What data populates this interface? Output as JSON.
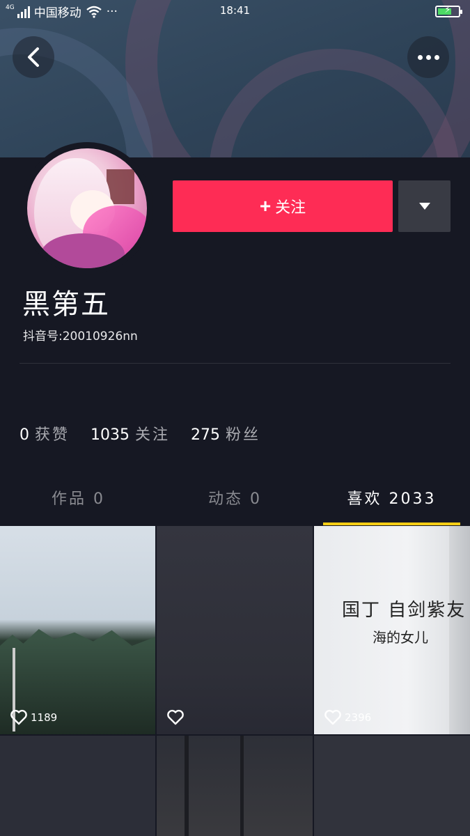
{
  "status_bar": {
    "network": "4G",
    "carrier": "中国移动",
    "more": "···",
    "time": "18:41"
  },
  "profile": {
    "nickname": "黑第五",
    "douyin_id": "抖音号:20010926nn",
    "follow_label": "关注",
    "follow_plus": "+"
  },
  "stats": [
    {
      "num": "0",
      "label": "获赞"
    },
    {
      "num": "1035",
      "label": "关注"
    },
    {
      "num": "275",
      "label": "粉丝"
    }
  ],
  "tabs": [
    {
      "label": "作品 0"
    },
    {
      "label": "动态 0"
    },
    {
      "label": "喜欢 2033"
    }
  ],
  "videos": [
    {
      "likes": "1189"
    },
    {
      "likes": ""
    },
    {
      "likes": "2396",
      "text_line1": "国丁 自剑紫友",
      "text_line2": "海的女儿"
    }
  ],
  "colors": {
    "background": "#161823",
    "follow": "#fe2c55",
    "tab_underline": "#face15"
  },
  "icons": [
    "back-icon",
    "more-icon",
    "wifi-icon",
    "battery-icon",
    "caret-down-icon",
    "heart-icon"
  ]
}
